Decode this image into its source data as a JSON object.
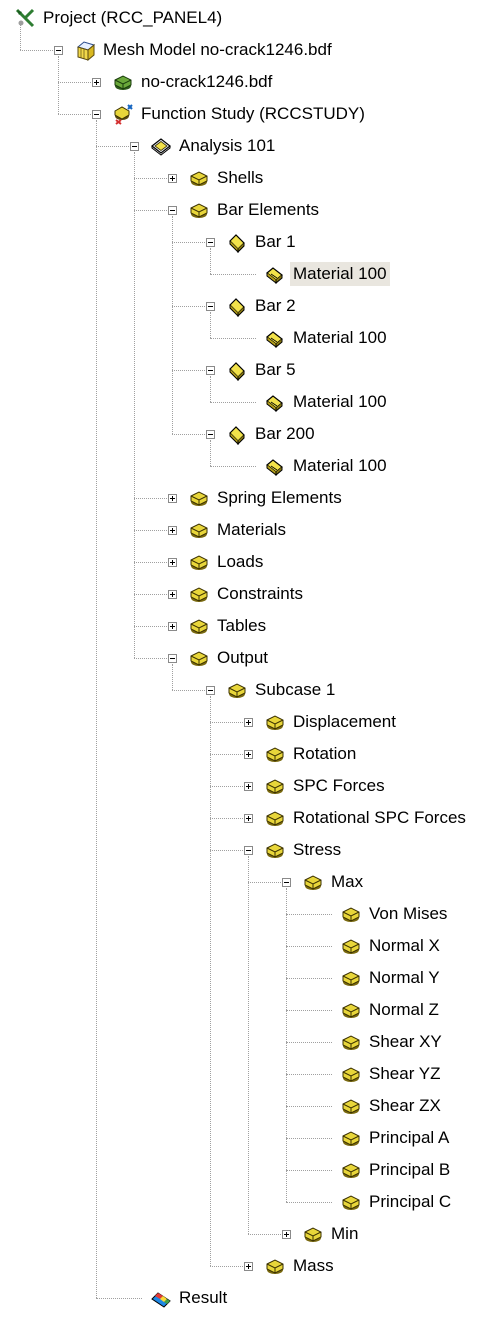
{
  "tree": {
    "nodes": [
      {
        "label": "Project (RCC_PANEL4)",
        "depth": 0,
        "expander": "none",
        "icon": "project-icon",
        "selected": false
      },
      {
        "label": "Mesh Model no-crack1246.bdf",
        "depth": 1,
        "expander": "expanded",
        "icon": "mesh-model-icon",
        "selected": false
      },
      {
        "label": "no-crack1246.bdf",
        "depth": 2,
        "expander": "collapsed",
        "icon": "bdf-file-icon",
        "selected": false
      },
      {
        "label": "Function Study (RCCSTUDY)",
        "depth": 2,
        "expander": "expanded",
        "icon": "function-study-icon",
        "selected": false
      },
      {
        "label": "Analysis 101",
        "depth": 3,
        "expander": "expanded",
        "icon": "analysis-icon",
        "selected": false
      },
      {
        "label": "Shells",
        "depth": 4,
        "expander": "collapsed",
        "icon": "folder-icon",
        "selected": false
      },
      {
        "label": "Bar Elements",
        "depth": 4,
        "expander": "expanded",
        "icon": "folder-icon",
        "selected": false
      },
      {
        "label": "Bar 1",
        "depth": 5,
        "expander": "expanded",
        "icon": "bar-icon",
        "selected": false
      },
      {
        "label": "Material 100",
        "depth": 6,
        "expander": "none",
        "icon": "material-icon",
        "selected": true
      },
      {
        "label": "Bar 2",
        "depth": 5,
        "expander": "expanded",
        "icon": "bar-icon",
        "selected": false
      },
      {
        "label": "Material 100",
        "depth": 6,
        "expander": "none",
        "icon": "material-icon",
        "selected": false
      },
      {
        "label": "Bar 5",
        "depth": 5,
        "expander": "expanded",
        "icon": "bar-icon",
        "selected": false
      },
      {
        "label": "Material 100",
        "depth": 6,
        "expander": "none",
        "icon": "material-icon",
        "selected": false
      },
      {
        "label": "Bar 200",
        "depth": 5,
        "expander": "expanded",
        "icon": "bar-icon",
        "selected": false
      },
      {
        "label": "Material 100",
        "depth": 6,
        "expander": "none",
        "icon": "material-icon",
        "selected": false
      },
      {
        "label": "Spring Elements",
        "depth": 4,
        "expander": "collapsed",
        "icon": "folder-icon",
        "selected": false
      },
      {
        "label": "Materials",
        "depth": 4,
        "expander": "collapsed",
        "icon": "folder-icon",
        "selected": false
      },
      {
        "label": "Loads",
        "depth": 4,
        "expander": "collapsed",
        "icon": "folder-icon",
        "selected": false
      },
      {
        "label": "Constraints",
        "depth": 4,
        "expander": "collapsed",
        "icon": "folder-icon",
        "selected": false
      },
      {
        "label": "Tables",
        "depth": 4,
        "expander": "collapsed",
        "icon": "folder-icon",
        "selected": false
      },
      {
        "label": "Output",
        "depth": 4,
        "expander": "expanded",
        "icon": "folder-icon",
        "selected": false
      },
      {
        "label": "Subcase 1",
        "depth": 5,
        "expander": "expanded",
        "icon": "folder-icon",
        "selected": false
      },
      {
        "label": "Displacement",
        "depth": 6,
        "expander": "collapsed",
        "icon": "folder-icon",
        "selected": false
      },
      {
        "label": "Rotation",
        "depth": 6,
        "expander": "collapsed",
        "icon": "folder-icon",
        "selected": false
      },
      {
        "label": "SPC Forces",
        "depth": 6,
        "expander": "collapsed",
        "icon": "folder-icon",
        "selected": false
      },
      {
        "label": "Rotational SPC Forces",
        "depth": 6,
        "expander": "collapsed",
        "icon": "folder-icon",
        "selected": false
      },
      {
        "label": "Stress",
        "depth": 6,
        "expander": "expanded",
        "icon": "folder-icon",
        "selected": false
      },
      {
        "label": "Max",
        "depth": 7,
        "expander": "expanded",
        "icon": "folder-icon",
        "selected": false
      },
      {
        "label": "Von Mises",
        "depth": 8,
        "expander": "none",
        "icon": "folder-icon",
        "selected": false
      },
      {
        "label": "Normal X",
        "depth": 8,
        "expander": "none",
        "icon": "folder-icon",
        "selected": false
      },
      {
        "label": "Normal Y",
        "depth": 8,
        "expander": "none",
        "icon": "folder-icon",
        "selected": false
      },
      {
        "label": "Normal Z",
        "depth": 8,
        "expander": "none",
        "icon": "folder-icon",
        "selected": false
      },
      {
        "label": "Shear XY",
        "depth": 8,
        "expander": "none",
        "icon": "folder-icon",
        "selected": false
      },
      {
        "label": "Shear YZ",
        "depth": 8,
        "expander": "none",
        "icon": "folder-icon",
        "selected": false
      },
      {
        "label": "Shear ZX",
        "depth": 8,
        "expander": "none",
        "icon": "folder-icon",
        "selected": false
      },
      {
        "label": "Principal A",
        "depth": 8,
        "expander": "none",
        "icon": "folder-icon",
        "selected": false
      },
      {
        "label": "Principal B",
        "depth": 8,
        "expander": "none",
        "icon": "folder-icon",
        "selected": false
      },
      {
        "label": "Principal C",
        "depth": 8,
        "expander": "none",
        "icon": "folder-icon",
        "selected": false
      },
      {
        "label": "Min",
        "depth": 7,
        "expander": "collapsed",
        "icon": "folder-icon",
        "selected": false
      },
      {
        "label": "Mass",
        "depth": 6,
        "expander": "collapsed",
        "icon": "folder-icon",
        "selected": false
      },
      {
        "label": "Result",
        "depth": 3,
        "expander": "none",
        "icon": "result-icon",
        "selected": false
      }
    ]
  },
  "colors": {
    "selected_background": "#e9e6df",
    "folder_fill": "#e8d63a",
    "folder_shadow": "#7a6a10",
    "tree_line": "#a0a0a0"
  }
}
